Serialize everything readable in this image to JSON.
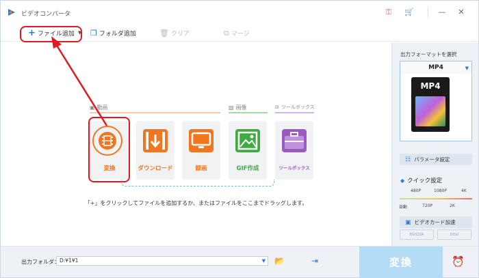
{
  "window": {
    "title": "ビデオコンバータ"
  },
  "toolbar": {
    "add_file": "ファイル追加",
    "add_folder": "フォルダ追加",
    "clear": "クリア",
    "merge": "マージ"
  },
  "categories": {
    "video": "動画",
    "image": "画像",
    "toolbox": "ツールボックス"
  },
  "tiles": [
    {
      "label": "変換",
      "icon": "film-convert-icon",
      "color": "#f2761f"
    },
    {
      "label": "ダウンロード",
      "icon": "download-icon",
      "color": "#f2761f"
    },
    {
      "label": "録画",
      "icon": "screen-record-icon",
      "color": "#f2761f"
    },
    {
      "label": "GIF作成",
      "icon": "image-icon",
      "color": "#3faa3f"
    },
    {
      "label": "ツールボックス",
      "icon": "toolbox-icon",
      "color": "#9b59c6"
    }
  ],
  "hint": "「+」をクリックしてファイルを追加するか、またはファイルをここまでドラッグします。",
  "right_panel": {
    "title": "出力フォーマットを選択",
    "format": "MP4",
    "format_thumb_text": "MP4",
    "param_button": "パラメータ設定",
    "quick_title": "クイック設定",
    "quality_top": [
      "480P",
      "1080P",
      "4K"
    ],
    "quality_bottom": [
      "自動",
      "720P",
      "2K"
    ],
    "gpu_button": "ビデオカード加速",
    "gpu_nvidia": "NVIDIA",
    "gpu_intel": "Intel"
  },
  "bottom": {
    "output_label": "出力フォルダ：",
    "output_path": "D:¥1¥1",
    "convert_button": "変換"
  },
  "colors": {
    "accent": "#2a7ad8",
    "highlight_red": "#e0191f",
    "convert_disabled": "#b4dcf7"
  }
}
